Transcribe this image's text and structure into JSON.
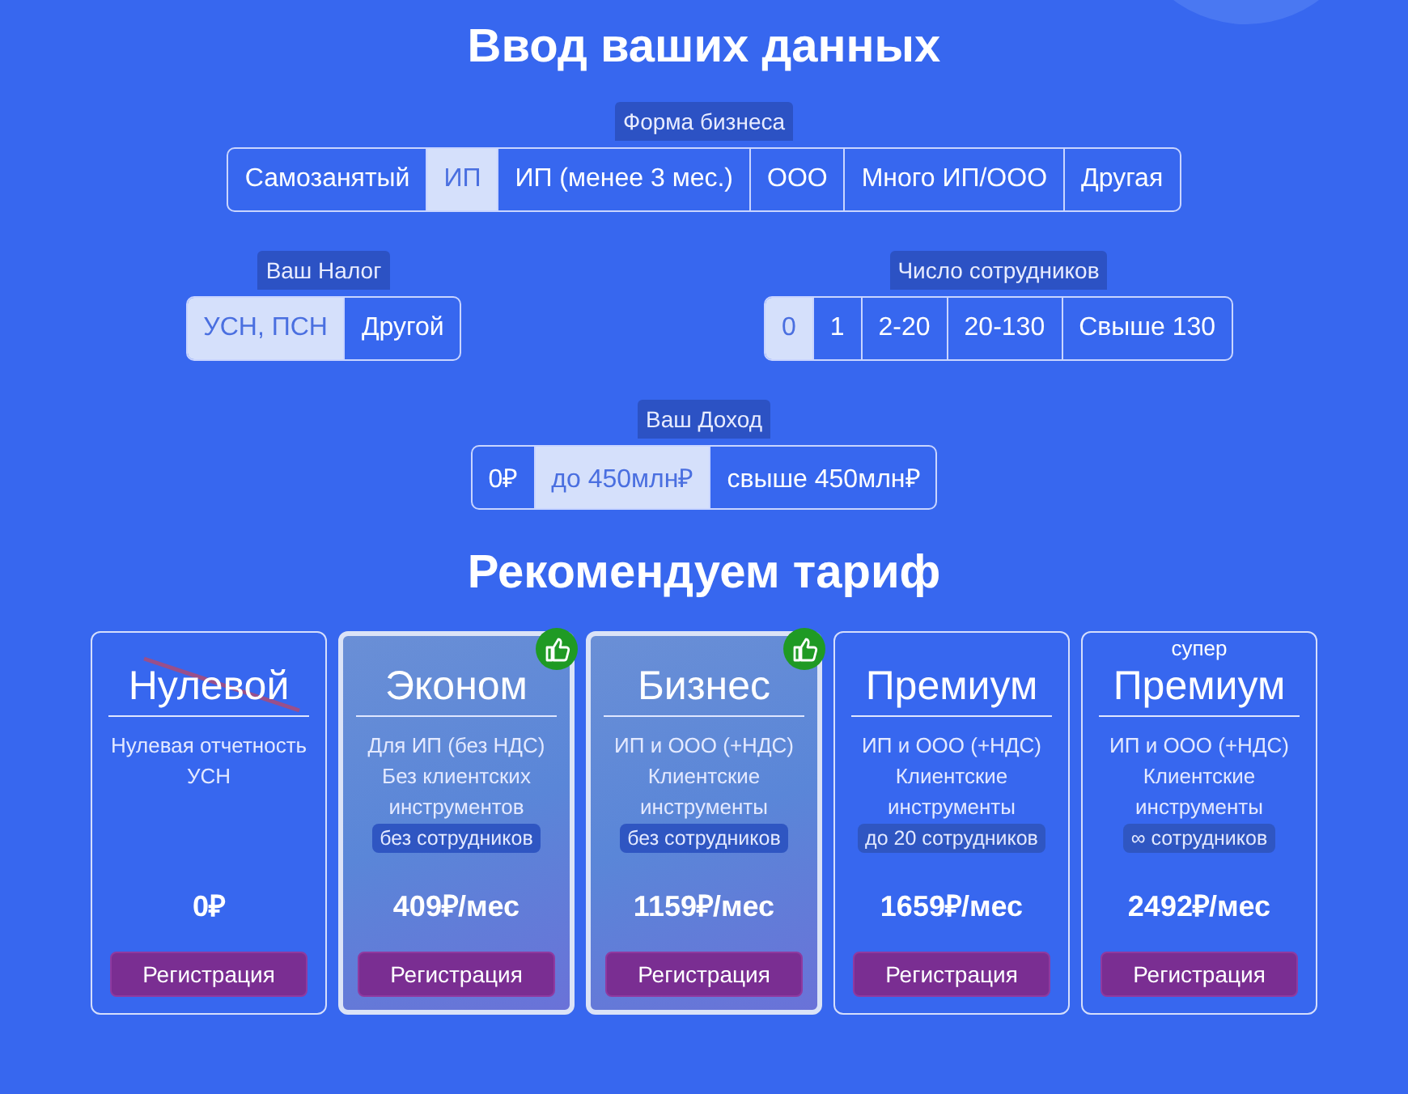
{
  "title": "Ввод ваших данных",
  "business_form": {
    "label": "Форма бизнеса",
    "options": [
      {
        "label": "Самозанятый",
        "selected": false
      },
      {
        "label": "ИП",
        "selected": true
      },
      {
        "label": "ИП (менее 3 мес.)",
        "selected": false
      },
      {
        "label": "ООО",
        "selected": false
      },
      {
        "label": "Много ИП/ООО",
        "selected": false
      },
      {
        "label": "Другая",
        "selected": false
      }
    ]
  },
  "tax": {
    "label": "Ваш Налог",
    "options": [
      {
        "label": "УСН, ПСН",
        "selected": true
      },
      {
        "label": "Другой",
        "selected": false
      }
    ]
  },
  "employees": {
    "label": "Число сотрудников",
    "options": [
      {
        "label": "0",
        "selected": true
      },
      {
        "label": "1",
        "selected": false
      },
      {
        "label": "2-20",
        "selected": false
      },
      {
        "label": "20-130",
        "selected": false
      },
      {
        "label": "Свыше 130",
        "selected": false
      }
    ]
  },
  "income": {
    "label": "Ваш Доход",
    "options": [
      {
        "label": "0₽",
        "selected": false
      },
      {
        "label": "до 450млн₽",
        "selected": true
      },
      {
        "label": "свыше 450млн₽",
        "selected": false
      }
    ]
  },
  "recommend_title": "Рекомендуем тариф",
  "plans": [
    {
      "name": "Нулевой",
      "struck": true,
      "recommended": false,
      "description": [
        "Нулевая отчетность УСН"
      ],
      "price": "0₽",
      "button": "Регистрация"
    },
    {
      "name": "Эконом",
      "struck": false,
      "recommended": true,
      "description": [
        "Для ИП (без НДС)",
        "Без клиентских инструментов"
      ],
      "tag": "без сотрудников",
      "price": "409₽/мес",
      "button": "Регистрация"
    },
    {
      "name": "Бизнес",
      "struck": false,
      "recommended": true,
      "description": [
        "ИП и ООО (+НДС)",
        "Клиентские инструменты"
      ],
      "tag": "без сотрудников",
      "price": "1159₽/мес",
      "button": "Регистрация"
    },
    {
      "name": "Премиум",
      "struck": false,
      "recommended": false,
      "description": [
        "ИП и ООО (+НДС)",
        "Клиентские инструменты"
      ],
      "tag": "до 20 сотрудников",
      "price": "1659₽/мес",
      "button": "Регистрация"
    },
    {
      "name": "Премиум",
      "prefix": "супер",
      "struck": false,
      "recommended": false,
      "description": [
        "ИП и ООО (+НДС)",
        "Клиентские инструменты"
      ],
      "tag": "∞ сотрудников",
      "price": "2492₽/мес",
      "button": "Регистрация"
    }
  ]
}
